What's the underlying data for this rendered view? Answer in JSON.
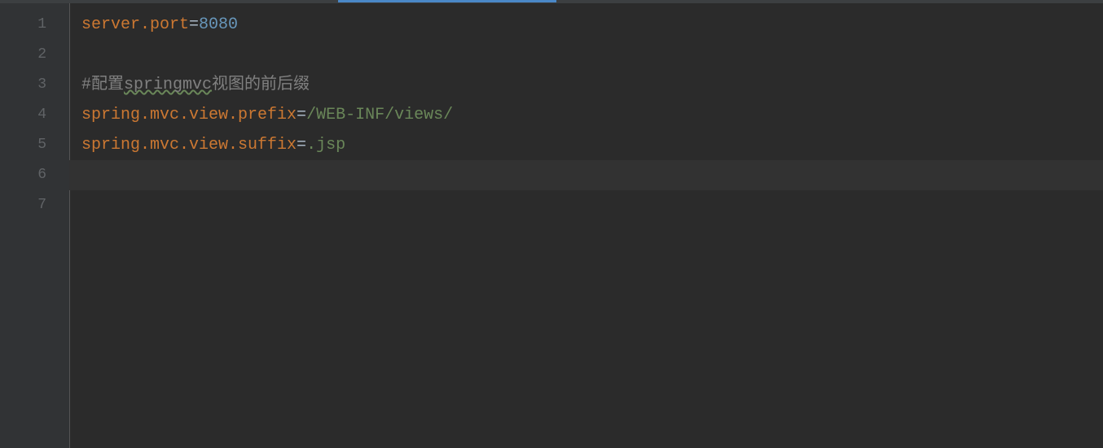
{
  "lineNumbers": [
    "1",
    "2",
    "3",
    "4",
    "5",
    "6",
    "7"
  ],
  "lines": {
    "line1": {
      "key": "server.port",
      "equals": "=",
      "value": "8080"
    },
    "line3": {
      "commentPrefix": "#配置",
      "commentTypo": "springmvc",
      "commentSuffix": "视图的前后缀"
    },
    "line4": {
      "key": "spring.mvc.view.prefix",
      "equals": "=",
      "value": "/WEB-INF/views/"
    },
    "line5": {
      "key": "spring.mvc.view.suffix",
      "equals": "=",
      "value": ".jsp"
    }
  },
  "currentLine": 6
}
